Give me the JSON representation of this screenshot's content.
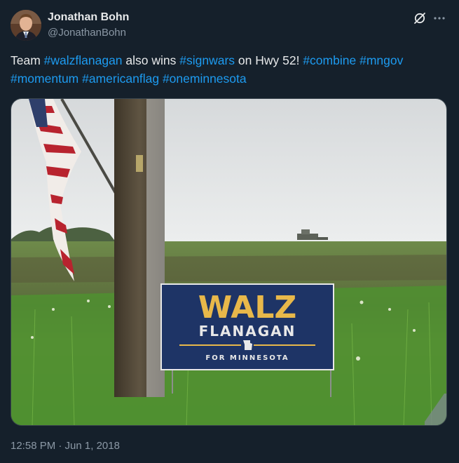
{
  "author": {
    "name": "Jonathan Bohn",
    "handle": "@JonathanBohn"
  },
  "tweet": {
    "segments": [
      {
        "text": "Team ",
        "type": "plain"
      },
      {
        "text": "#walzflanagan",
        "type": "hashtag"
      },
      {
        "text": " also wins ",
        "type": "plain"
      },
      {
        "text": "#signwars",
        "type": "hashtag"
      },
      {
        "text": " on Hwy 52! ",
        "type": "plain"
      },
      {
        "text": "#combine",
        "type": "hashtag"
      },
      {
        "text": " ",
        "type": "plain"
      },
      {
        "text": "#mngov",
        "type": "hashtag"
      },
      {
        "text": " ",
        "type": "plain"
      },
      {
        "text": "#momentum",
        "type": "hashtag"
      },
      {
        "text": " ",
        "type": "plain"
      },
      {
        "text": "#americanflag",
        "type": "hashtag"
      },
      {
        "text": " ",
        "type": "plain"
      },
      {
        "text": "#oneminnesota",
        "type": "hashtag"
      }
    ],
    "timestamp": "12:58 PM · Jun 1, 2018"
  },
  "media": {
    "sign_line1": "WALZ",
    "sign_line2": "FLANAGAN",
    "sign_line3": "FOR MINNESOTA"
  },
  "icons": {
    "grok": "grok-icon",
    "more": "more-icon"
  },
  "colors": {
    "background": "#15202b",
    "link": "#1d9bf0",
    "secondary_text": "#8b98a5",
    "sign_blue": "#1e3466",
    "sign_gold": "#e8b84a"
  }
}
